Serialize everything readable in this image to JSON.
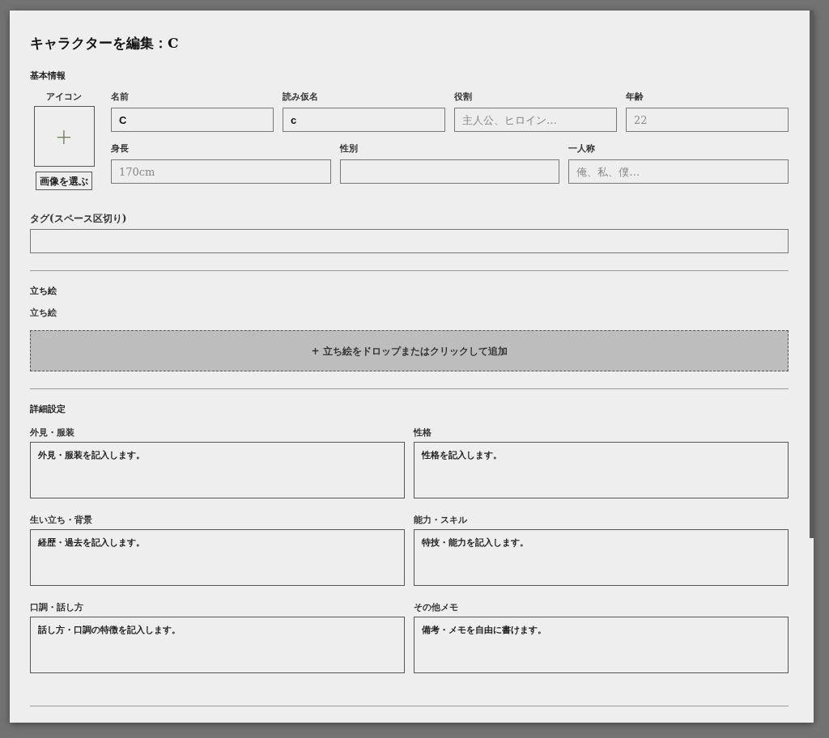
{
  "dialog": {
    "title": "キャラクターを編集：C"
  },
  "basic_info": {
    "heading": "基本情報",
    "icon": {
      "label": "アイコン",
      "add_symbol": "+",
      "button": "画像を選ぶ"
    },
    "field_groups": [
      {
        "fields": [
          {
            "label": "名前",
            "value": "C"
          },
          {
            "label": "読み仮名",
            "value": "c"
          },
          {
            "label": "役割",
            "placeholder": "主人公、ヒロイン…"
          },
          {
            "label": "年齢",
            "placeholder": "22"
          }
        ]
      },
      {
        "fields": [
          {
            "label": "身長",
            "placeholder": "170cm"
          },
          {
            "label": "性別"
          },
          {
            "label": "一人称",
            "placeholder": "俺、私、僕…"
          }
        ]
      }
    ],
    "tags": {
      "label": "タグ(スペース区切り)"
    }
  },
  "portrait": {
    "heading": "立ち絵",
    "label": "立ち絵",
    "dropzone": "+ 立ち絵をドロップまたはクリックして追加"
  },
  "details": {
    "heading": "詳細設定",
    "fields": [
      {
        "label": "外見・服装",
        "value": "外見・服装を記入します。"
      },
      {
        "label": "性格",
        "value": "性格を記入します。"
      },
      {
        "label": "生い立ち・背景",
        "value": "経歴・過去を記入します。"
      },
      {
        "label": "能力・スキル",
        "value": "特技・能力を記入します。"
      },
      {
        "label": "口調・話し方",
        "value": "話し方・口調の特徴を記入します。"
      },
      {
        "label": "その他メモ",
        "value": "備考・メモを自由に書けます。"
      }
    ]
  }
}
